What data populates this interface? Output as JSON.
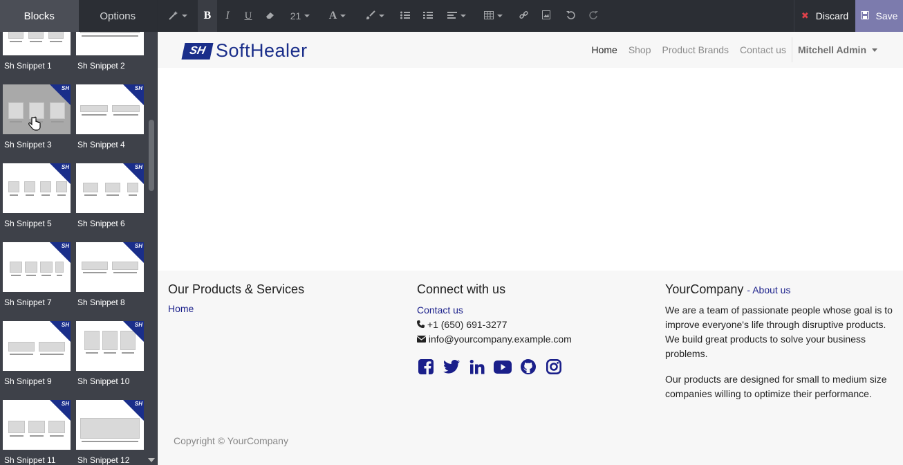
{
  "panel": {
    "tabs": [
      "Blocks",
      "Options"
    ]
  },
  "snippets": [
    {
      "label": "Sh Snippet 1"
    },
    {
      "label": "Sh Snippet 2"
    },
    {
      "label": "Sh Snippet 3"
    },
    {
      "label": "Sh Snippet 4"
    },
    {
      "label": "Sh Snippet 5"
    },
    {
      "label": "Sh Snippet 6"
    },
    {
      "label": "Sh Snippet 7"
    },
    {
      "label": "Sh Snippet 8"
    },
    {
      "label": "Sh Snippet 9"
    },
    {
      "label": "Sh Snippet 10"
    },
    {
      "label": "Sh Snippet 11"
    },
    {
      "label": "Sh Snippet 12"
    }
  ],
  "snippet_badge": "SH",
  "toolbar": {
    "font_size": "21",
    "discard_label": "Discard",
    "save_label": "Save"
  },
  "site": {
    "logo_mark": "SH",
    "logo_text": "SoftHealer",
    "nav": [
      "Home",
      "Shop",
      "Product Brands",
      "Contact us"
    ],
    "user": "Mitchell Admin"
  },
  "footer": {
    "col1_title": "Our Products & Services",
    "col1_link": "Home",
    "col2_title": "Connect with us",
    "col2_link": "Contact us",
    "phone": "+1 (650) 691-3277",
    "email": "info@yourcompany.example.com",
    "col3_title": "YourCompany",
    "col3_link": "- About us",
    "about1": "We are a team of passionate people whose goal is to improve everyone's life through disruptive products. We build great products to solve your business problems.",
    "about2": "Our products are designed for small to medium size companies willing to optimize their performance.",
    "copyright": "Copyright © YourCompany"
  },
  "colors": {
    "brand": "#1a2e8a",
    "save": "#7c7bad",
    "discard_x": "#e0414a",
    "link": "#1a1f8a"
  }
}
